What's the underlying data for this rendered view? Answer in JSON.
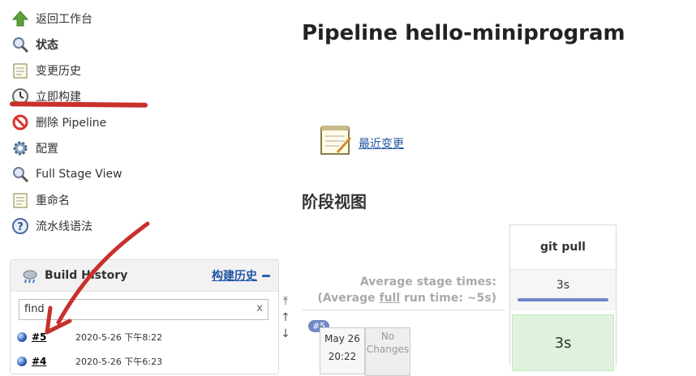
{
  "sidebar": {
    "items": [
      {
        "label": "返回工作台",
        "icon": "up-arrow-icon",
        "bold": false
      },
      {
        "label": "状态",
        "icon": "search-icon",
        "bold": true
      },
      {
        "label": "变更历史",
        "icon": "notepad-icon",
        "bold": false
      },
      {
        "label": "立即构建",
        "icon": "clock-build-icon",
        "bold": false
      },
      {
        "label": "删除 Pipeline",
        "icon": "no-entry-icon",
        "bold": false
      },
      {
        "label": "配置",
        "icon": "gear-icon",
        "bold": false
      },
      {
        "label": "Full Stage View",
        "icon": "search-icon",
        "bold": false
      },
      {
        "label": "重命名",
        "icon": "notepad-icon",
        "bold": false
      },
      {
        "label": "流水线语法",
        "icon": "help-icon",
        "bold": false
      }
    ]
  },
  "build_history": {
    "title": "Build History",
    "link": "构建历史",
    "find_value": "find",
    "clear": "x",
    "builds": [
      {
        "num": "#5",
        "date": "2020-5-26 下午8:22"
      },
      {
        "num": "#4",
        "date": "2020-5-26 下午6:23"
      }
    ]
  },
  "main": {
    "title": "Pipeline hello-miniprogram",
    "recent_changes": "最近变更",
    "stage_view_title": "阶段视图",
    "avg_line1": "Average stage times:",
    "avg_line2_pre": "(Average ",
    "avg_line2_full": "full",
    "avg_line2_post": " run time: ~5s)",
    "stage": {
      "name": "git pull",
      "avg": "3s",
      "cell": "3s"
    },
    "run": {
      "badge": "#5",
      "date": "May 26",
      "time": "20:22",
      "changes": "No Changes"
    }
  },
  "colors": {
    "link": "#2055a6",
    "annotation": "#c9302c",
    "success_cell": "#dff2dc"
  }
}
